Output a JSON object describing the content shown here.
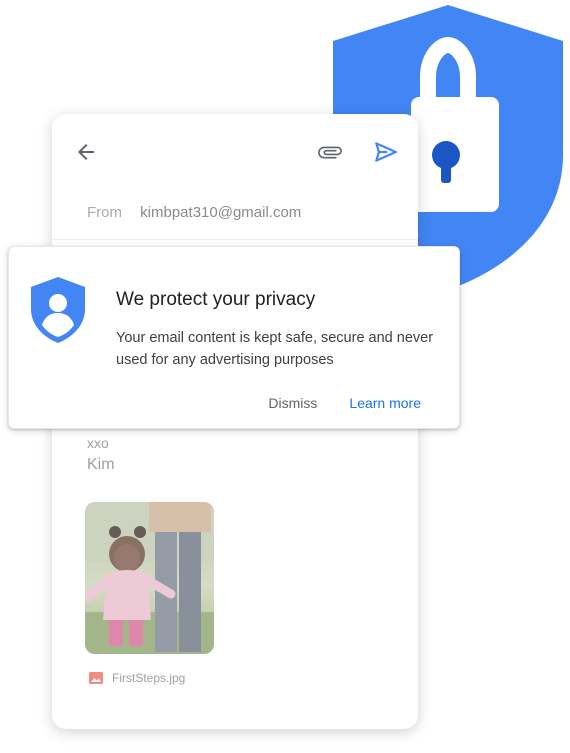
{
  "colors": {
    "brand_blue": "#4285f4",
    "link_blue": "#1a73e8",
    "lock_dark_blue": "#1a56c4"
  },
  "email": {
    "from_label": "From",
    "from_address": "kimbpat310@gmail.com",
    "signoff": "xxo",
    "sender_name": "Kim",
    "attachment_name": "FirstSteps.jpg"
  },
  "privacy_card": {
    "title": "We protect your privacy",
    "body": "Your email content is kept safe, secure and never used for any advertising purposes",
    "dismiss_label": "Dismiss",
    "learn_more_label": "Learn more"
  },
  "icons": [
    "shield-lock-icon",
    "back-arrow-icon",
    "paperclip-icon",
    "send-icon",
    "shield-person-icon",
    "image-icon"
  ]
}
